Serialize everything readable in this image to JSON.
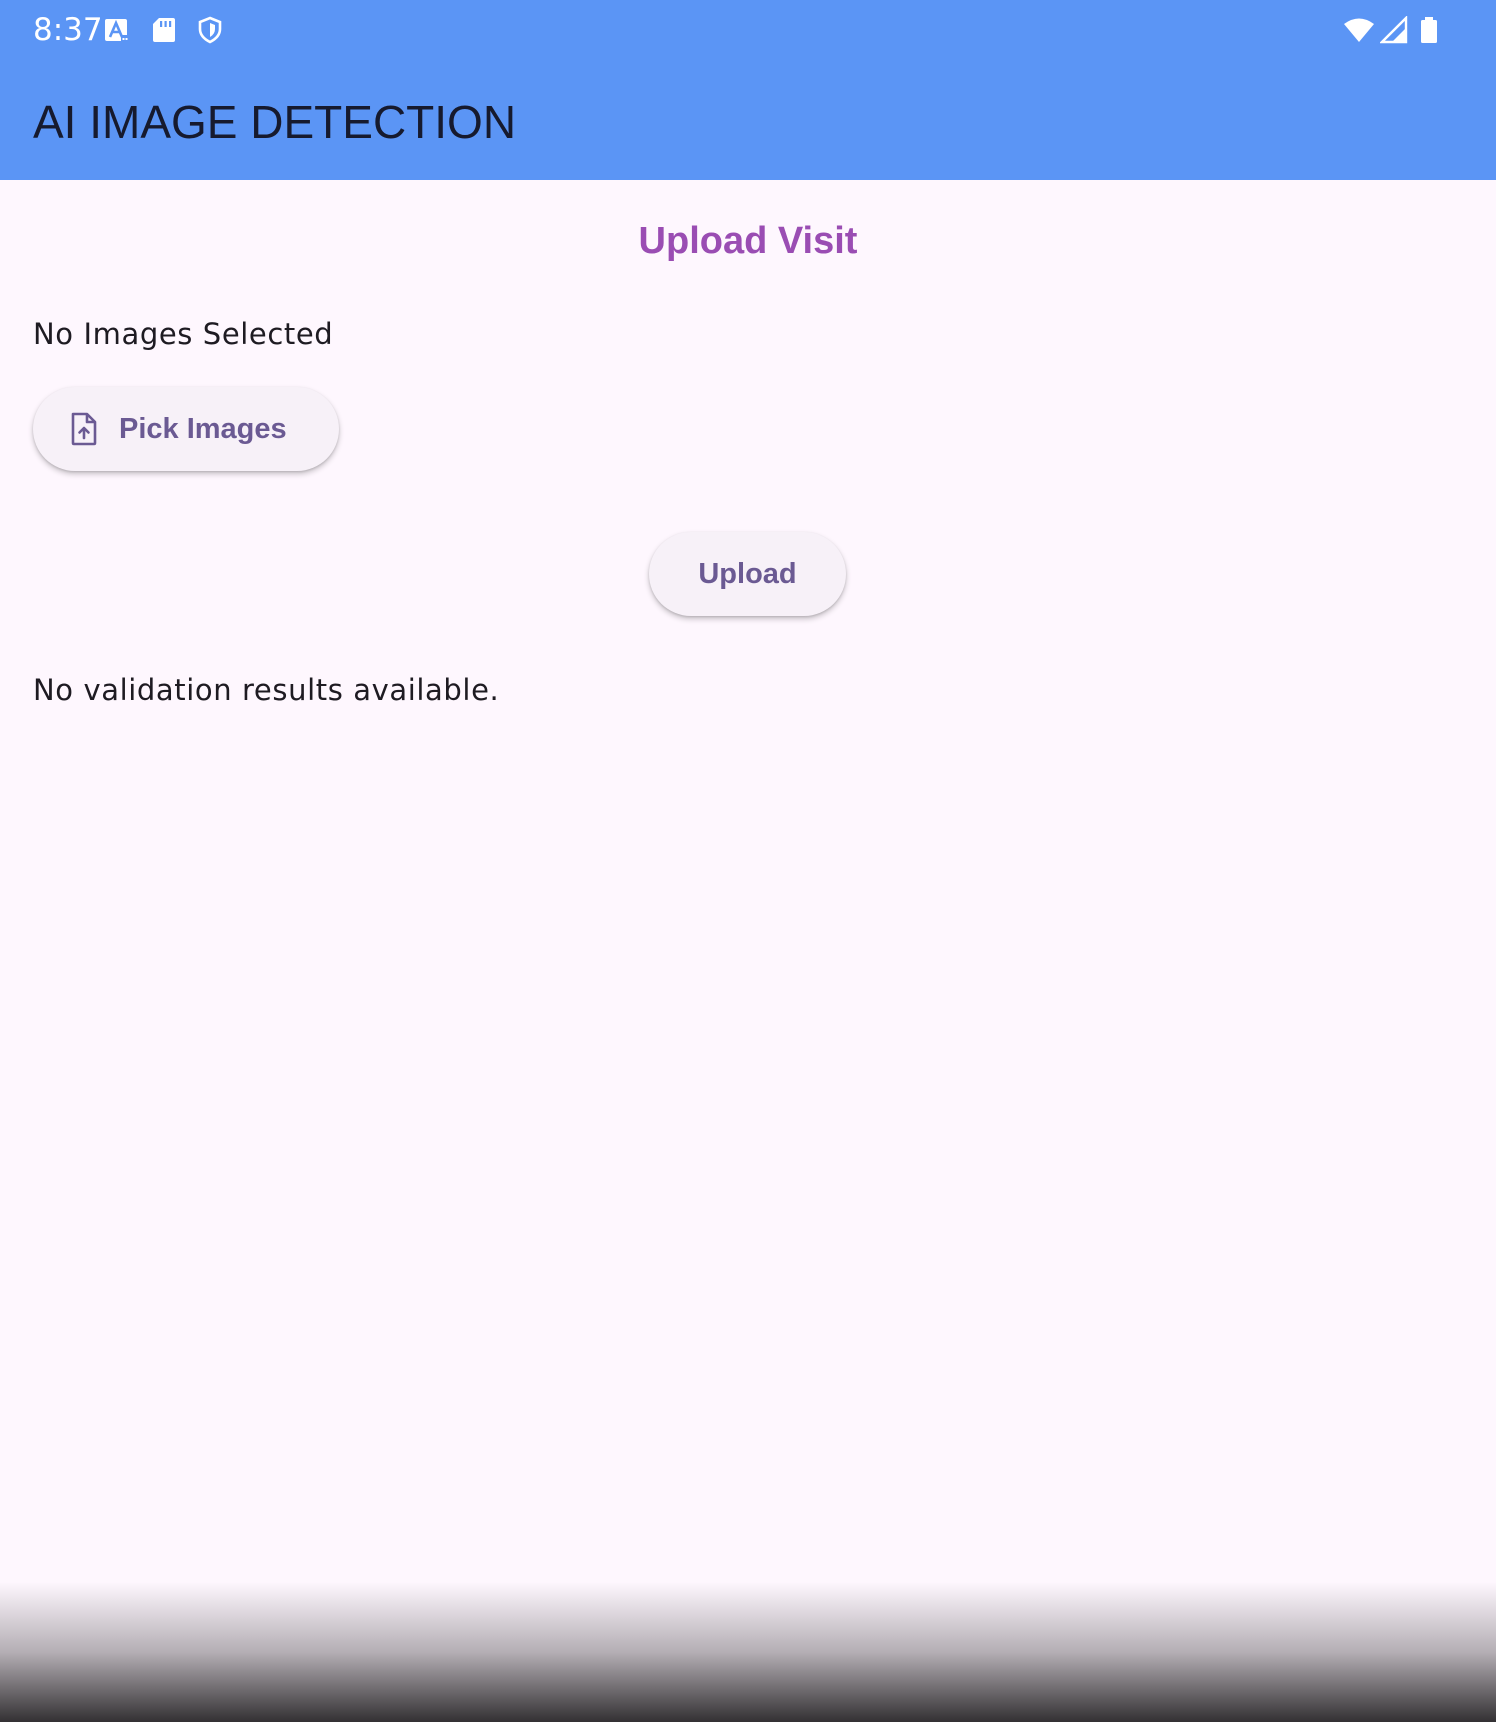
{
  "status_bar": {
    "time": "8:37",
    "left_icons": [
      "a-notification-icon",
      "sd-card-icon",
      "shield-icon"
    ],
    "right_icons": [
      "wifi-icon",
      "signal-icon",
      "battery-icon"
    ]
  },
  "app_bar": {
    "title": "AI IMAGE DETECTION",
    "color": "#5b95f5"
  },
  "main": {
    "heading": "Upload Visit",
    "heading_color": "#9a4db3",
    "images_status": "No Images Selected",
    "pick_button": {
      "label": "Pick Images",
      "icon": "file-upload-icon"
    },
    "upload_button": {
      "label": "Upload"
    },
    "results_status": "No validation results available."
  }
}
